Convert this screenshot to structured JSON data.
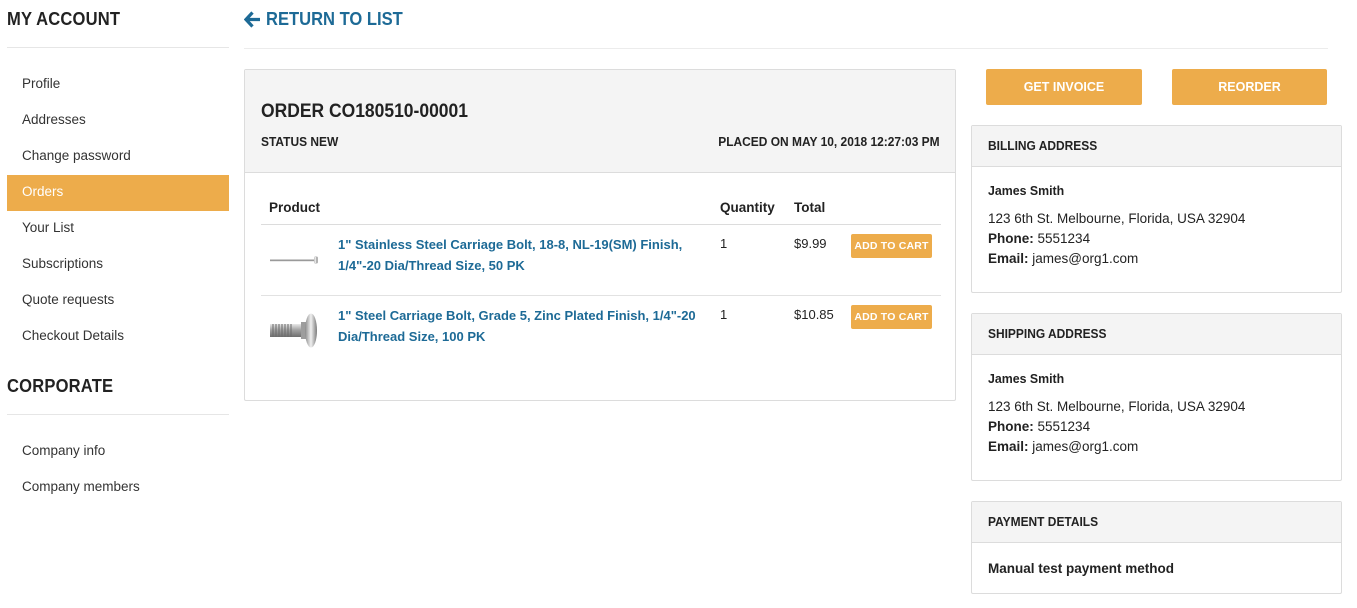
{
  "sidebar": {
    "account_heading": "MY ACCOUNT",
    "account_items": [
      {
        "label": "Profile"
      },
      {
        "label": "Addresses"
      },
      {
        "label": "Change password"
      },
      {
        "label": "Orders"
      },
      {
        "label": "Your List"
      },
      {
        "label": "Subscriptions"
      },
      {
        "label": "Quote requests"
      },
      {
        "label": "Checkout Details"
      }
    ],
    "active_item": "Orders",
    "corporate_heading": "CORPORATE",
    "corporate_items": [
      {
        "label": "Company info"
      },
      {
        "label": "Company members"
      }
    ]
  },
  "header": {
    "return_label": "RETURN TO LIST",
    "return_icon": "arrow-left-icon"
  },
  "order": {
    "title": "ORDER CO180510-00001",
    "status": "STATUS NEW",
    "placed": "PLACED ON MAY 10, 2018 12:27:03 PM",
    "columns": {
      "product": "Product",
      "quantity": "Quantity",
      "total": "Total"
    },
    "items": [
      {
        "name": "1\" Stainless Steel Carriage Bolt, 18-8, NL-19(SM) Finish, 1/4\"-20 Dia/Thread Size, 50 PK",
        "quantity": "1",
        "total": "$9.99",
        "add_label": "ADD TO CART",
        "image": "thin-bolt-image"
      },
      {
        "name": "1\" Steel Carriage Bolt, Grade 5, Zinc Plated Finish, 1/4\"-20 Dia/Thread Size, 100 PK",
        "quantity": "1",
        "total": "$10.85",
        "add_label": "ADD TO CART",
        "image": "carriage-bolt-image"
      }
    ]
  },
  "actions": {
    "invoice_label": "GET INVOICE",
    "reorder_label": "REORDER"
  },
  "billing": {
    "heading": "BILLING ADDRESS",
    "name": "James Smith",
    "address": "123 6th St. Melbourne, Florida, USA 32904",
    "phone_label": "Phone:",
    "phone": "5551234",
    "email_label": "Email:",
    "email": "james@org1.com"
  },
  "shipping": {
    "heading": "SHIPPING ADDRESS",
    "name": "James Smith",
    "address": "123 6th St. Melbourne, Florida, USA 32904",
    "phone_label": "Phone:",
    "phone": "5551234",
    "email_label": "Email:",
    "email": "james@org1.com"
  },
  "payment": {
    "heading": "PAYMENT DETAILS",
    "method": "Manual test payment method"
  },
  "colors": {
    "accent": "#edac4b",
    "link": "#1d6a96",
    "panel_header_bg": "#f4f4f4"
  }
}
